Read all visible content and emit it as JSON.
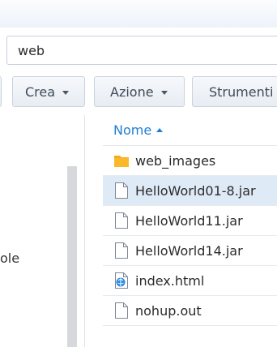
{
  "path": {
    "value": "web"
  },
  "toolbar": {
    "create_label": "Crea",
    "action_label": "Azione",
    "tools_label": "Strumenti"
  },
  "left_pane": {
    "label_fragment": "ole"
  },
  "file_list": {
    "sort_column": "Nome",
    "sort_direction": "ascending",
    "rows": [
      {
        "name": "web_images",
        "icon": "folder-icon",
        "selected": false
      },
      {
        "name": "HelloWorld01-8.jar",
        "icon": "file-icon",
        "selected": true
      },
      {
        "name": "HelloWorld11.jar",
        "icon": "file-icon",
        "selected": false
      },
      {
        "name": "HelloWorld14.jar",
        "icon": "file-icon",
        "selected": false
      },
      {
        "name": "index.html",
        "icon": "html-file-icon",
        "selected": false
      },
      {
        "name": "nohup.out",
        "icon": "file-icon",
        "selected": false
      }
    ]
  },
  "colors": {
    "accent": "#1f7ed6",
    "selected_row": "#dfeaf7",
    "folder": "#f6a81a"
  }
}
